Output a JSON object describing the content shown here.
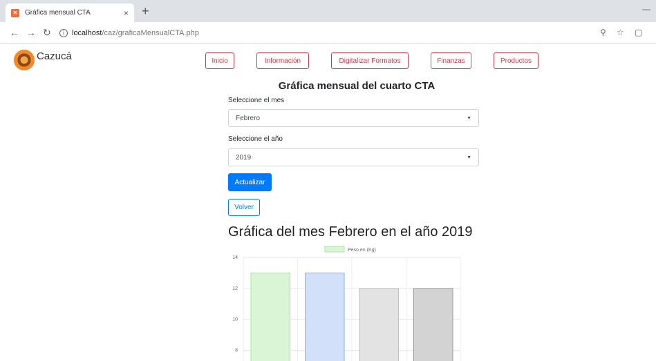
{
  "browser": {
    "tab_title": "Gráfica mensual CTA",
    "tab_close": "×",
    "new_tab": "+",
    "url_host": "localhost",
    "url_path": "/caz/graficaMensualCTA.php"
  },
  "brand": {
    "name": "Cazucá"
  },
  "nav": {
    "items": [
      "Inicio",
      "Información",
      "Digitalizar Formatos",
      "Finanzas",
      "Productos"
    ]
  },
  "form": {
    "title": "Gráfica mensual del cuarto CTA",
    "month_label": "Seleccione el mes",
    "month_value": "Febrero",
    "year_label": "Seleccione el año",
    "year_value": "2019",
    "update_button": "Actualizar",
    "back_button": "Volver"
  },
  "chart_title": "Gráfica del mes Febrero en el año 2019",
  "chart_data": {
    "type": "bar",
    "legend": "Peso en (Kg)",
    "categories": [
      "",
      "",
      "",
      ""
    ],
    "values": [
      13,
      13,
      12,
      12
    ],
    "ylim": [
      7,
      14
    ],
    "yticks": [
      14,
      12,
      10,
      8
    ],
    "colors": [
      {
        "fill": "#d9f5d6",
        "stroke": "#a8e6a0"
      },
      {
        "fill": "#d2e0fa",
        "stroke": "#8aaef0"
      },
      {
        "fill": "#e3e3e3",
        "stroke": "#bdbdbd"
      },
      {
        "fill": "#d3d3d3",
        "stroke": "#9a9a9a"
      }
    ],
    "grid": true,
    "legend_position": "top"
  }
}
